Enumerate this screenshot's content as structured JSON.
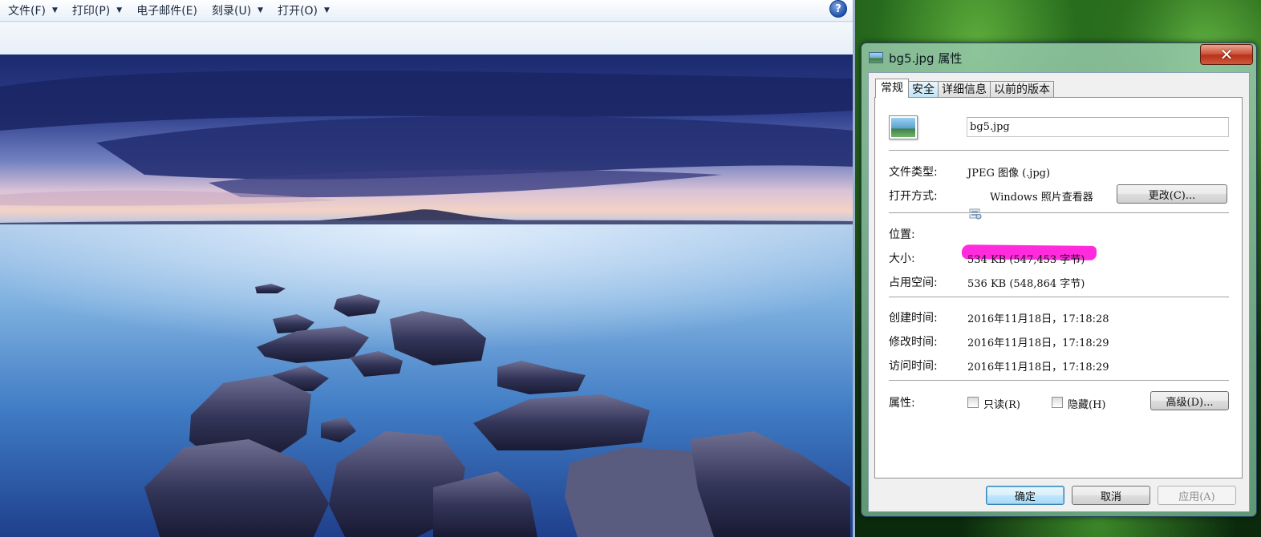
{
  "viewer": {
    "menu": [
      {
        "label": "文件(F)",
        "has_dropdown": true
      },
      {
        "label": "打印(P)",
        "has_dropdown": true
      },
      {
        "label": "电子邮件(E)",
        "has_dropdown": false
      },
      {
        "label": "刻录(U)",
        "has_dropdown": true
      },
      {
        "label": "打开(O)",
        "has_dropdown": true
      }
    ],
    "help_glyph": "?",
    "dropdown_glyph": "▼",
    "photo_icon": "landscape-photo"
  },
  "dialog": {
    "title": "bg5.jpg 属性",
    "close_glyph": "✕",
    "tabs": [
      {
        "label": "常规",
        "active": true
      },
      {
        "label": "安全",
        "active": false
      },
      {
        "label": "详细信息",
        "active": false
      },
      {
        "label": "以前的版本",
        "active": false
      }
    ],
    "general": {
      "filename": "bg5.jpg",
      "file_type_label": "文件类型:",
      "file_type_value": "JPEG 图像 (.jpg)",
      "opens_with_label": "打开方式:",
      "opens_with_value": "Windows 照片查看器",
      "change_button": "更改(C)...",
      "location_label": "位置:",
      "location_value_redacted": true,
      "size_label": "大小:",
      "size_value": "534 KB (547,453 字节)",
      "size_on_disk_label": "占用空间:",
      "size_on_disk_value": "536 KB (548,864 字节)",
      "created_label": "创建时间:",
      "created_value": "2016年11月18日，17:18:28",
      "modified_label": "修改时间:",
      "modified_value": "2016年11月18日，17:18:29",
      "accessed_label": "访问时间:",
      "accessed_value": "2016年11月18日，17:18:29",
      "attributes_label": "属性:",
      "readonly_label": "只读(R)",
      "readonly_checked": false,
      "hidden_label": "隐藏(H)",
      "hidden_checked": false,
      "advanced_button": "高级(D)..."
    },
    "buttons": {
      "ok": "确定",
      "cancel": "取消",
      "apply": "应用(A)"
    }
  },
  "colors": {
    "redaction": "#ff2bdc",
    "close_button": "#c8412a",
    "default_button_border": "#3c7fb1"
  }
}
